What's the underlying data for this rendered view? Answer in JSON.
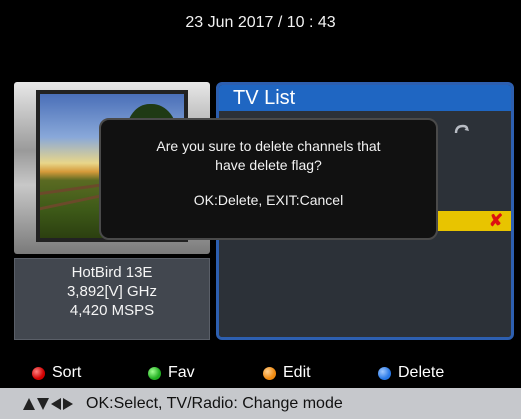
{
  "header": {
    "datetime": "23 Jun 2017 / 10 : 43"
  },
  "satellite": {
    "name": "HotBird 13E",
    "frequency": "3,892[V] GHz",
    "symbol_rate": "4,420 MSPS"
  },
  "tv_list": {
    "title": "TV List",
    "icons": [
      "undo-icon",
      "delete-flag-icon"
    ],
    "highlight_color": "#e8c400"
  },
  "dialog": {
    "message": "Are you sure to delete channels that have delete flag?",
    "hint": "OK:Delete, EXIT:Cancel"
  },
  "color_keys": [
    {
      "color": "red",
      "label": "Sort"
    },
    {
      "color": "green",
      "label": "Fav"
    },
    {
      "color": "orange",
      "label": "Edit"
    },
    {
      "color": "blue",
      "label": "Delete"
    }
  ],
  "footer": {
    "hint": "OK:Select, TV/Radio: Change mode",
    "icon": "navigation-arrows-icon"
  }
}
